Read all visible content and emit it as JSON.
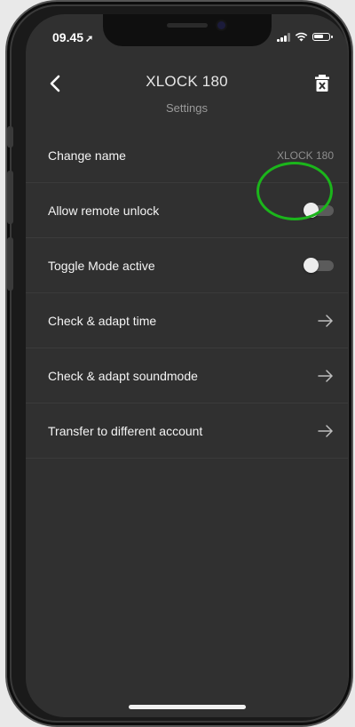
{
  "status_bar": {
    "time": "09.45",
    "location_glyph": "➚"
  },
  "header": {
    "title": "XLOCK 180",
    "subtitle": "Settings",
    "back_icon": "chevron-left-icon",
    "delete_icon": "trash-icon"
  },
  "settings": {
    "change_name": {
      "label": "Change name",
      "value": "XLOCK 180"
    },
    "remote_unlock": {
      "label": "Allow remote unlock",
      "enabled": false
    },
    "toggle_mode": {
      "label": "Toggle Mode active",
      "enabled": false
    },
    "adapt_time": {
      "label": "Check & adapt time"
    },
    "adapt_soundmode": {
      "label": "Check & adapt soundmode"
    },
    "transfer_account": {
      "label": "Transfer to different account"
    }
  },
  "colors": {
    "screen_bg": "#303030",
    "divider": "#3b3b3b",
    "highlight": "#1bb51b",
    "toggle_off_track": "#5b5b5b"
  }
}
